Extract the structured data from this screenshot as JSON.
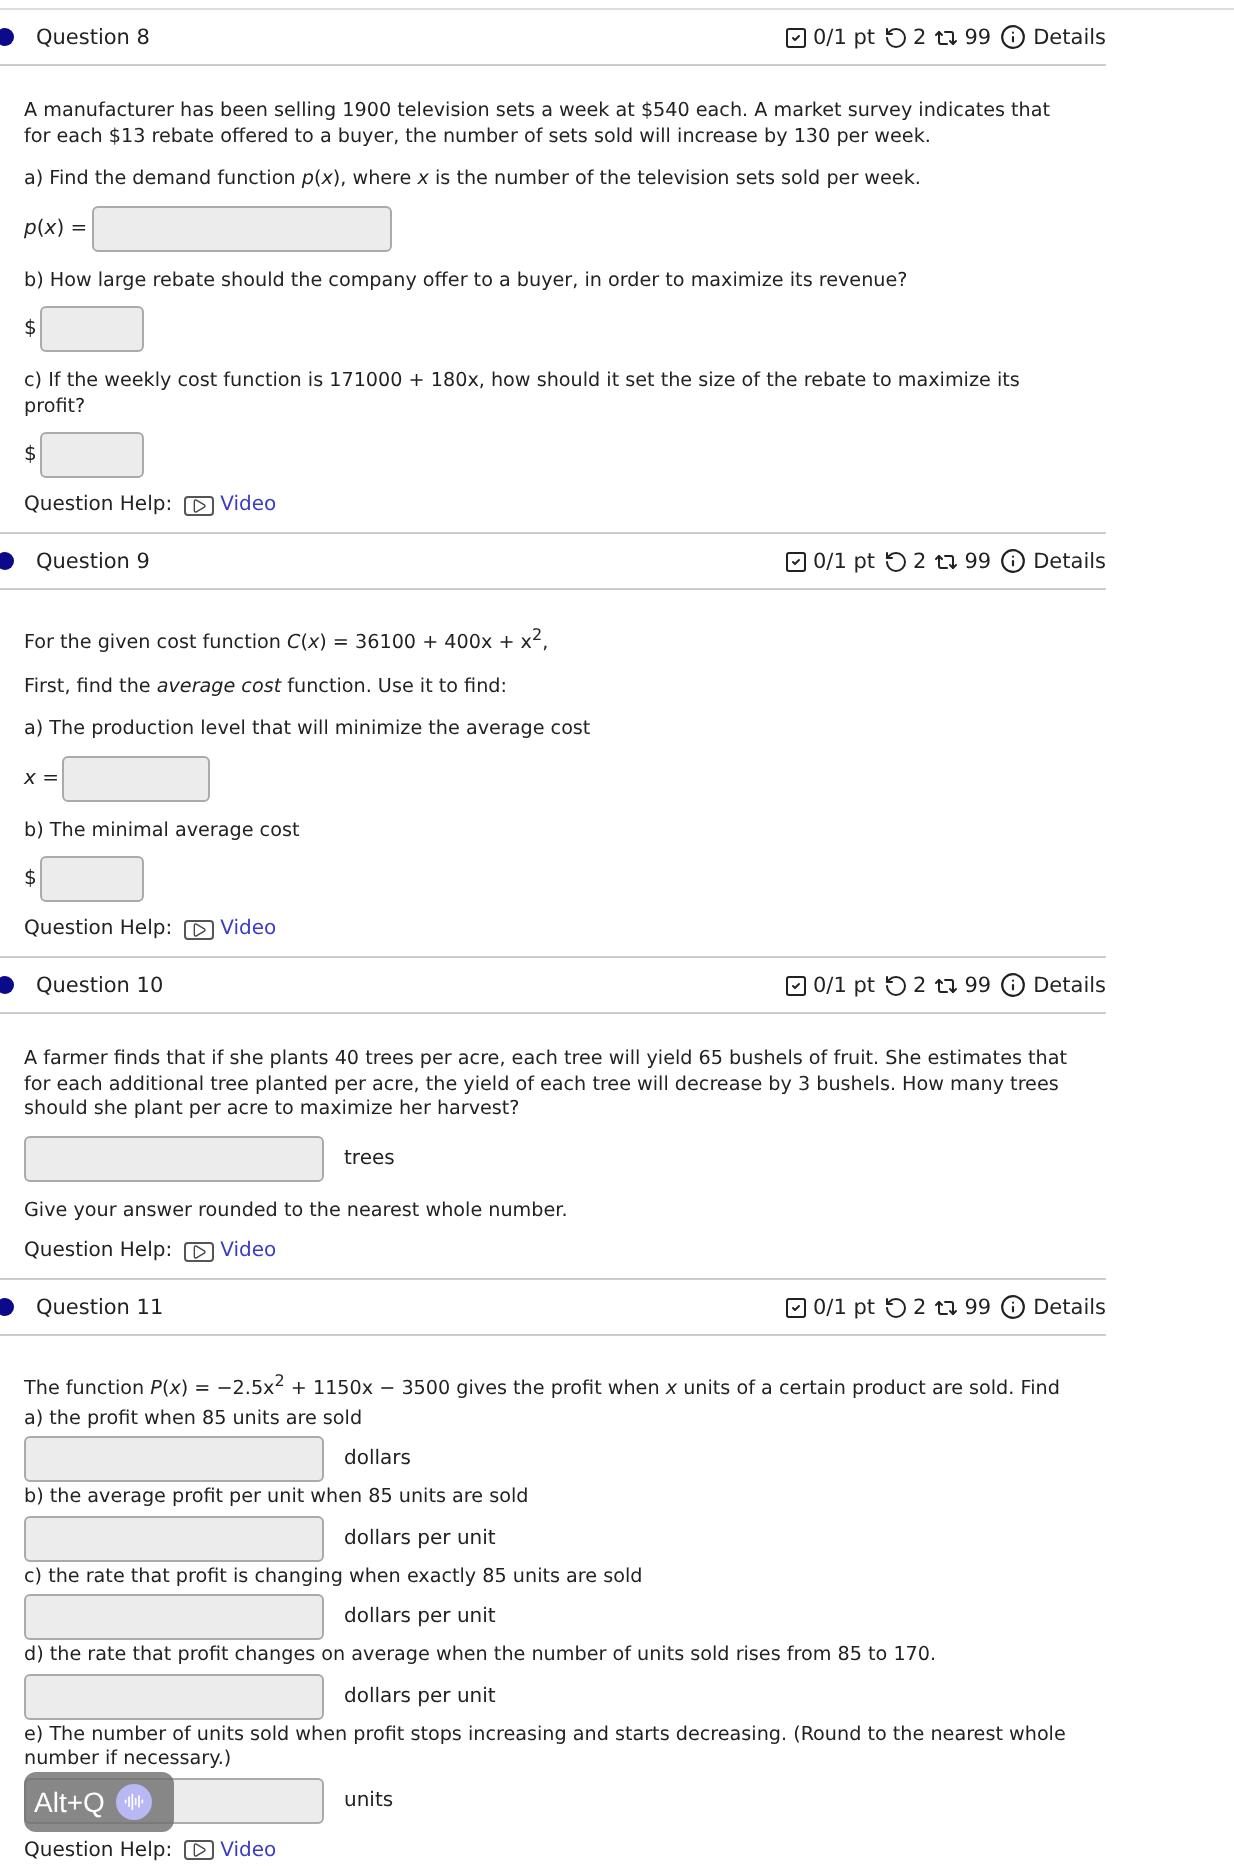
{
  "questions": [
    {
      "title": "Question 8",
      "score": "0/1 pt",
      "retries": "2",
      "attempts": "99",
      "details": "Details",
      "blocks": [
        {
          "kind": "text",
          "text": "A manufacturer has been selling 1900 television sets a week at $540 each. A market survey indicates that for each $13 rebate offered to a buyer, the number of sets sold will increase by 130 per week."
        },
        {
          "kind": "text",
          "text": "a) Find the demand function *p*(*x*), where *x* is the number of the television sets sold per week."
        },
        {
          "kind": "long-field",
          "prefix": "*p*(*x*) ="
        },
        {
          "kind": "text",
          "text": "b) How large rebate should the company offer to a buyer, in order to maximize its revenue?"
        },
        {
          "kind": "short-field",
          "prefix": "$"
        },
        {
          "kind": "text",
          "text": "c) If the weekly cost function is 171000 + 180x, how should it set the size of the rebate to maximize its profit?"
        },
        {
          "kind": "short-field",
          "prefix": "$"
        },
        {
          "kind": "help",
          "label": "Question Help:",
          "link": "Video"
        }
      ]
    },
    {
      "title": "Question 9",
      "score": "0/1 pt",
      "retries": "2",
      "attempts": "99",
      "details": "Details",
      "blocks": [
        {
          "kind": "text",
          "text": "For the given cost function *C*(*x*) = 36100 + 400x + x$^{2}$,"
        },
        {
          "kind": "text",
          "text": "First, find the *average cost* function. Use it to find:"
        },
        {
          "kind": "text",
          "text": "a) The production level that will minimize the average cost"
        },
        {
          "kind": "short-field",
          "prefix": "*x* ="
        },
        {
          "kind": "text",
          "text": "b) The minimal average cost"
        },
        {
          "kind": "short-field",
          "prefix": "$"
        },
        {
          "kind": "help",
          "label": "Question Help:",
          "link": "Video"
        }
      ]
    },
    {
      "title": "Question 10",
      "score": "0/1 pt",
      "retries": "2",
      "attempts": "99",
      "details": "Details",
      "blocks": [
        {
          "kind": "text",
          "text": "A farmer finds that if she plants 40 trees per acre, each tree will yield 65 bushels of fruit. She estimates that for each additional tree planted per acre, the yield of each tree will decrease by 3 bushels. How many trees should she plant per acre to maximize her harvest?"
        },
        {
          "kind": "long-field",
          "unit": "trees"
        },
        {
          "kind": "text",
          "text": "Give your answer rounded to the nearest whole number."
        },
        {
          "kind": "help",
          "label": "Question Help:",
          "link": "Video"
        }
      ]
    },
    {
      "title": "Question 11",
      "score": "0/1 pt",
      "retries": "2",
      "attempts": "99",
      "details": "Details",
      "blocks": [
        {
          "kind": "text",
          "text": "The function *P*(*x*) = −2.5x$^{2}$ + 1150x − 3500 gives the profit when *x* units of a certain product are sold. Find"
        },
        {
          "kind": "part",
          "prompt": "a) the profit when 85 units are sold",
          "unit": "dollars"
        },
        {
          "kind": "part",
          "prompt": "b) the average profit per unit when 85 units are sold",
          "unit": "dollars per unit"
        },
        {
          "kind": "part",
          "prompt": "c) the rate that profit is changing when exactly 85 units are sold",
          "unit": "dollars per unit"
        },
        {
          "kind": "part",
          "prompt": "d) the rate that profit changes on average when the number of units sold rises from 85 to 170.",
          "unit": "dollars per unit"
        },
        {
          "kind": "part",
          "prompt": "e) The number of units sold when profit stops increasing and starts decreasing. (Round to the nearest whole number if necessary.)",
          "unit": "units"
        },
        {
          "kind": "help",
          "label": "Question Help:",
          "link": "Video"
        }
      ]
    }
  ],
  "shortcut_badge": {
    "label": "Alt+Q"
  }
}
